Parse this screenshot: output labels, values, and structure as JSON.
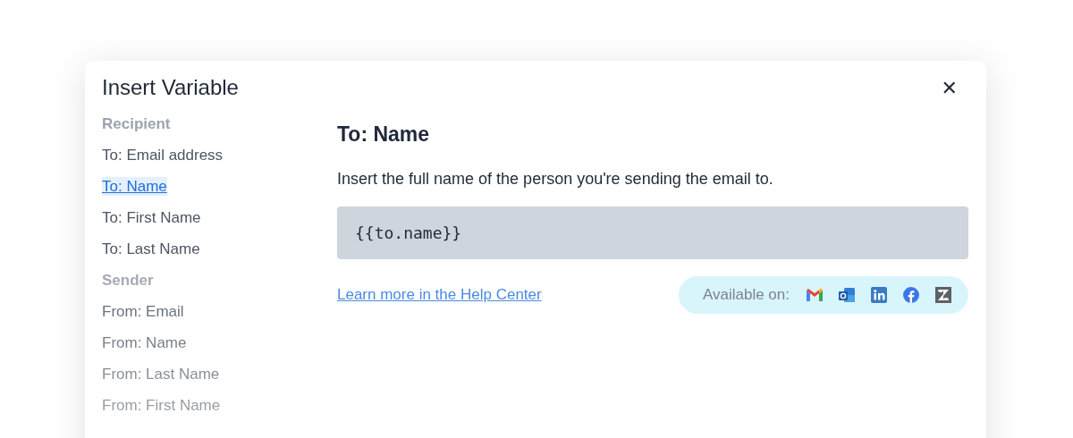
{
  "dialog": {
    "title": "Insert Variable",
    "close": "✕"
  },
  "sidebar": {
    "items": [
      {
        "kind": "header",
        "label": "Recipient"
      },
      {
        "kind": "item",
        "label": "To: Email address",
        "selected": false
      },
      {
        "kind": "item",
        "label": "To: Name",
        "selected": true
      },
      {
        "kind": "item",
        "label": "To: First Name",
        "selected": false
      },
      {
        "kind": "item",
        "label": "To: Last Name",
        "selected": false
      },
      {
        "kind": "header",
        "label": "Sender"
      },
      {
        "kind": "item",
        "label": "From: Email",
        "selected": false
      },
      {
        "kind": "item",
        "label": "From: Name",
        "selected": false
      },
      {
        "kind": "item",
        "label": "From: Last Name",
        "selected": false
      },
      {
        "kind": "item",
        "label": "From: First Name",
        "selected": false
      }
    ]
  },
  "detail": {
    "heading": "To: Name",
    "description": "Insert the full name of the person you're sending the email to.",
    "code": "{{to.name}}",
    "help_link": "Learn more in the Help Center",
    "availability": {
      "label": "Available on:",
      "platforms": [
        {
          "kind": "gmail"
        },
        {
          "kind": "outlook"
        },
        {
          "kind": "linkedin"
        },
        {
          "kind": "facebook"
        },
        {
          "kind": "zendesk"
        }
      ]
    }
  }
}
